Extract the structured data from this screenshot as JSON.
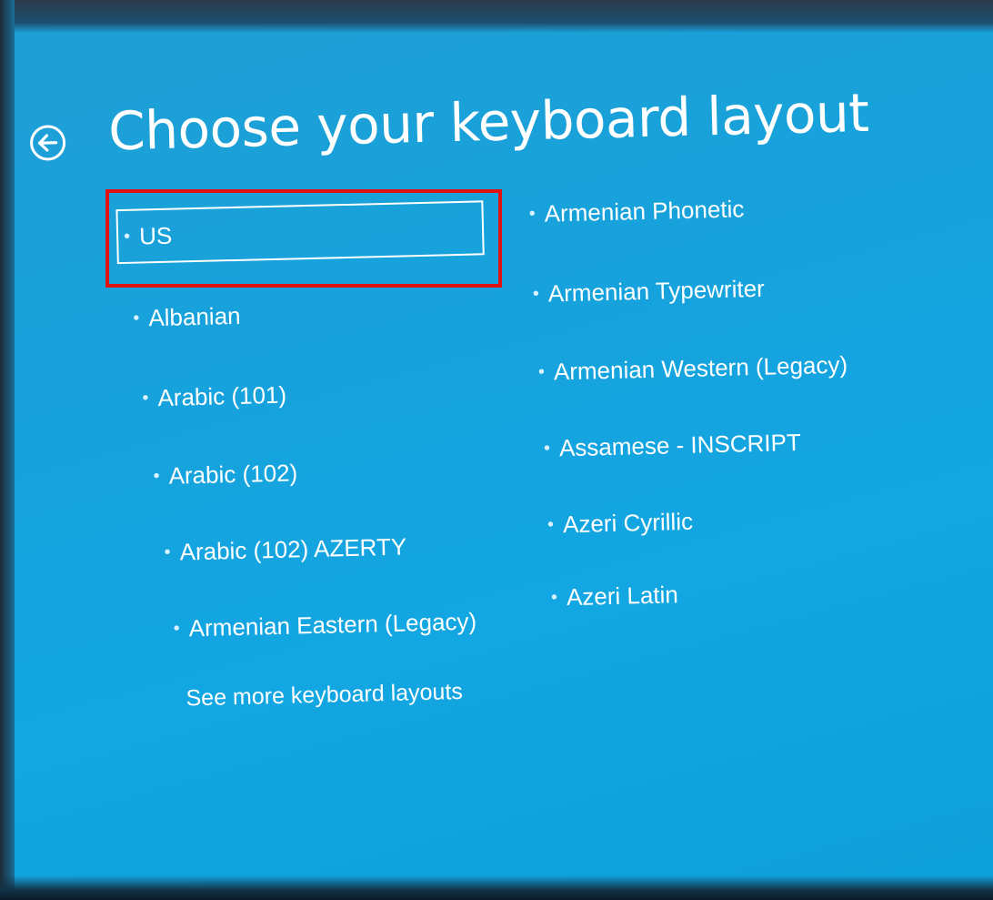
{
  "page": {
    "title": "Choose your keyboard layout",
    "back_icon": "back-arrow-icon"
  },
  "layouts_left": [
    {
      "label": "US",
      "selected": true
    },
    {
      "label": "Albanian",
      "selected": false
    },
    {
      "label": "Arabic (101)",
      "selected": false
    },
    {
      "label": "Arabic (102)",
      "selected": false
    },
    {
      "label": "Arabic (102) AZERTY",
      "selected": false
    },
    {
      "label": "Armenian Eastern (Legacy)",
      "selected": false
    }
  ],
  "layouts_right": [
    {
      "label": "Armenian Phonetic"
    },
    {
      "label": "Armenian Typewriter"
    },
    {
      "label": "Armenian Western (Legacy)"
    },
    {
      "label": "Assamese - INSCRIPT"
    },
    {
      "label": "Azeri Cyrillic"
    },
    {
      "label": "Azeri Latin"
    }
  ],
  "see_more": "See more keyboard layouts",
  "bullet_glyph": "•",
  "colors": {
    "background": "#12a6e2",
    "text": "#ffffff",
    "highlight": "#e11111"
  }
}
